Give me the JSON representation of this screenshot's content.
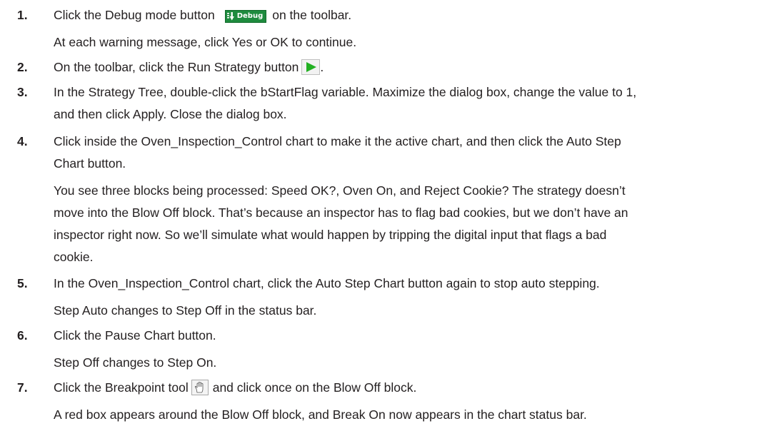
{
  "steps": [
    {
      "number": "1.",
      "lines": [
        "Click the Debug mode button",
        "on the toolbar."
      ],
      "debug_button_label": "Debug",
      "note": "At each warning message, click Yes or OK to continue."
    },
    {
      "number": "2.",
      "lines": [
        "On the toolbar, click the Run Strategy button",
        "."
      ]
    },
    {
      "number": "3.",
      "lines": [
        "In the Strategy Tree, double-click the bStartFlag variable. Maximize the dialog box, change the value to 1,",
        "and then click Apply. Close the dialog box."
      ]
    },
    {
      "number": "4.",
      "lines": [
        "Click inside the Oven_Inspection_Control chart to make it the active chart, and then click the Auto Step",
        "Chart button."
      ],
      "note_lines": [
        "You see three blocks being processed: Speed OK?, Oven On, and Reject Cookie? The strategy doesn’t",
        "move into the Blow Off block. That’s because an inspector has to flag bad cookies, but we don’t have an",
        "inspector right now. So we’ll simulate what would happen by tripping the digital input that flags a bad",
        "cookie."
      ]
    },
    {
      "number": "5.",
      "lines": [
        "In the Oven_Inspection_Control chart, click the Auto Step Chart button again to stop auto stepping."
      ],
      "note": "Step Auto changes to Step Off in the status bar."
    },
    {
      "number": "6.",
      "lines": [
        "Click the Pause Chart button."
      ],
      "note": "Step Off changes to Step On."
    },
    {
      "number": "7.",
      "lines": [
        "Click the Breakpoint tool",
        "and click once on the Blow Off block."
      ],
      "note": "A red box appears around the Blow Off block, and Break On now appears in the chart status bar."
    }
  ],
  "icons": {
    "debug": "debug-mode-icon",
    "run": "run-strategy-icon",
    "breakpoint": "breakpoint-hand-icon"
  },
  "colors": {
    "text": "#231f20",
    "debug_button": "#1e8b3e",
    "run_arrow": "#22b022"
  }
}
